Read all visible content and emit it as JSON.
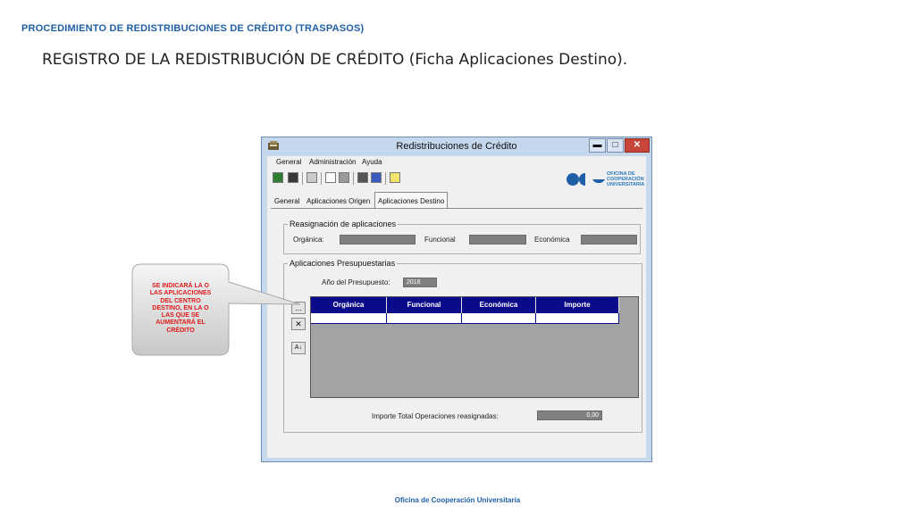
{
  "slide": {
    "header": "PROCEDIMIENTO DE REDISTRIBUCIONES DE CRÉDITO (TRASPASOS)",
    "title": "REGISTRO DE LA REDISTRIBUCIÓN DE CRÉDITO (Ficha Aplicaciones Destino).",
    "footer": "Oficina de Cooperación Universitaria"
  },
  "window": {
    "title": "Redistribuciones de Crédito",
    "min_glyph": "▬",
    "max_glyph": "□",
    "close_glyph": "✕",
    "menu": [
      "General",
      "Administración",
      "Ayuda"
    ],
    "logo_text": [
      "OFICINA DE",
      "COOPERACIÓN",
      "UNIVERSITARIA"
    ],
    "tabs": [
      "General",
      "Aplicaciones Origen",
      "Aplicaciones Destino"
    ],
    "active_tab": "Aplicaciones Destino"
  },
  "reasignacion": {
    "title": "Reasignación de aplicaciones",
    "organica_label": "Orgánica:",
    "funcional_label": "Funcional",
    "economica_label": "Económica"
  },
  "aplicaciones": {
    "title": "Aplicaciones Presupuestarias",
    "anio_label": "Año del Presupuesto:",
    "anio_value": "2018",
    "columns": [
      "Orgánica",
      "Funcional",
      "Económica",
      "Importe"
    ],
    "side_buttons": [
      "...",
      "✕",
      "A↓"
    ],
    "total_label": "Importe Total Operaciones reasignadas:",
    "total_value": "0,00"
  },
  "callout": {
    "lines": [
      "SE INDICARÁ LA O",
      "LAS APLICACIONES",
      "DEL CENTRO",
      "DESTINO, EN LA O",
      "LAS  QUE SE",
      "AUMENTARÁ EL",
      "CRÉDITO"
    ]
  },
  "colors": {
    "header_blue": "#1f5fa8",
    "callout_red": "#e01a1a",
    "grid_header": "#0a0a8a",
    "window_frame": "#c7d9ec"
  },
  "icons": {
    "toolbar": [
      "exit-icon",
      "save-icon",
      "edit-icon",
      "preview-icon",
      "print-icon",
      "calc-icon",
      "report-icon",
      "help-icon"
    ],
    "title": "app-icon"
  }
}
